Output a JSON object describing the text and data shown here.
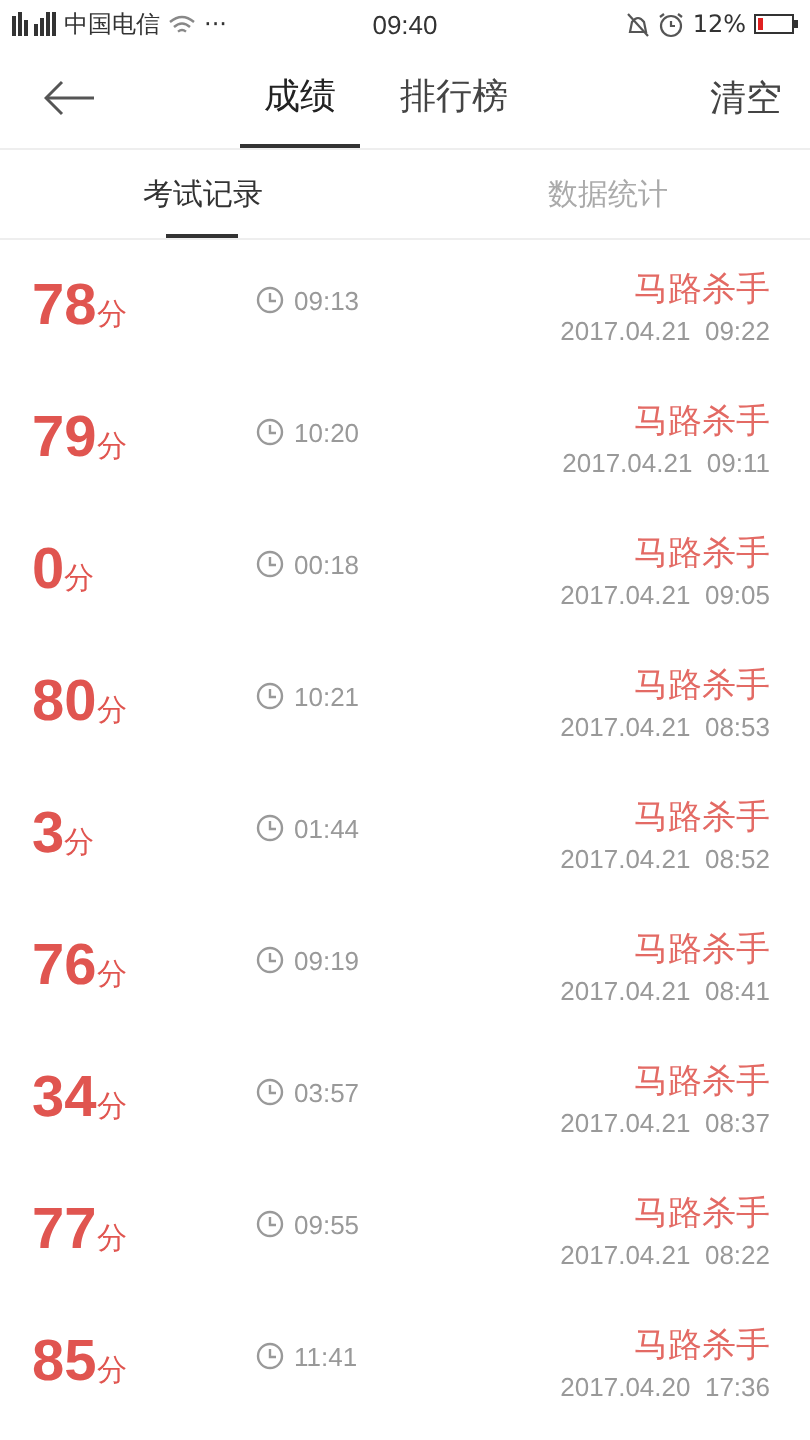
{
  "status_bar": {
    "carrier": "中国电信",
    "dots": "···",
    "time": "09:40",
    "battery": "12%"
  },
  "header": {
    "tabs": [
      {
        "label": "成绩",
        "selected": true
      },
      {
        "label": "排行榜",
        "selected": false
      }
    ],
    "action": "清空"
  },
  "sub_tabs": [
    {
      "label": "考试记录",
      "selected": true
    },
    {
      "label": "数据统计",
      "selected": false
    }
  ],
  "records": [
    {
      "score": "78",
      "unit": "分",
      "duration": "09:13",
      "title": "马路杀手",
      "date": "2017.04.21  09:22"
    },
    {
      "score": "79",
      "unit": "分",
      "duration": "10:20",
      "title": "马路杀手",
      "date": "2017.04.21  09:11"
    },
    {
      "score": "0",
      "unit": "分",
      "duration": "00:18",
      "title": "马路杀手",
      "date": "2017.04.21  09:05"
    },
    {
      "score": "80",
      "unit": "分",
      "duration": "10:21",
      "title": "马路杀手",
      "date": "2017.04.21  08:53"
    },
    {
      "score": "3",
      "unit": "分",
      "duration": "01:44",
      "title": "马路杀手",
      "date": "2017.04.21  08:52"
    },
    {
      "score": "76",
      "unit": "分",
      "duration": "09:19",
      "title": "马路杀手",
      "date": "2017.04.21  08:41"
    },
    {
      "score": "34",
      "unit": "分",
      "duration": "03:57",
      "title": "马路杀手",
      "date": "2017.04.21  08:37"
    },
    {
      "score": "77",
      "unit": "分",
      "duration": "09:55",
      "title": "马路杀手",
      "date": "2017.04.21  08:22"
    },
    {
      "score": "85",
      "unit": "分",
      "duration": "11:41",
      "title": "马路杀手",
      "date": "2017.04.20  17:36"
    }
  ]
}
